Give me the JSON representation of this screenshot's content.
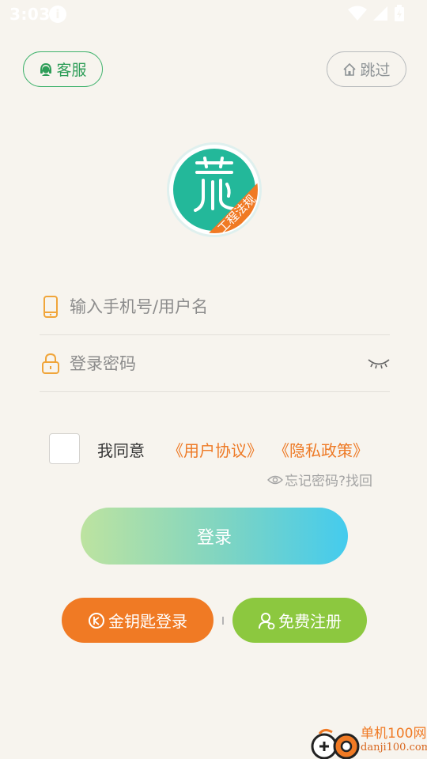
{
  "status_bar": {
    "time": "3:03",
    "info_glyph": "i"
  },
  "header": {
    "service_label": "客服",
    "skip_label": "跳过"
  },
  "logo": {
    "ribbon_text": "工程法规",
    "icon": "app-logo-icon"
  },
  "login_form": {
    "username_placeholder": "输入手机号/用户名",
    "password_placeholder": "登录密码"
  },
  "agreement": {
    "prefix": "我同意",
    "user_agreement": "《用户协议》",
    "privacy_policy": "《隐私政策》",
    "checked": false
  },
  "forgot_password": "忘记密码?找回",
  "login_button": "登录",
  "golden_key_button": "金钥匙登录",
  "register_button": "免费注册",
  "watermark": {
    "name": "单机100网",
    "domain": "danji100.com"
  },
  "colors": {
    "background": "#f7f4ee",
    "service_green": "#2e9d58",
    "accent_orange": "#f07a24",
    "register_green": "#8cc83f",
    "logo_teal": "#23b89a"
  }
}
